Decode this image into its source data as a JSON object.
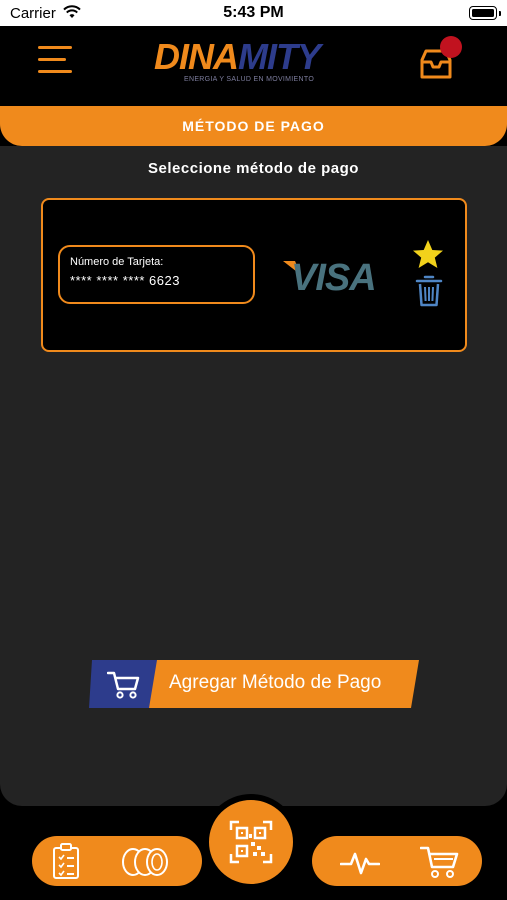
{
  "status_bar": {
    "carrier": "Carrier",
    "time": "5:43 PM"
  },
  "header": {
    "logo_part1": "DINA",
    "logo_part2": "MITY",
    "logo_tagline": "ENERGIA Y SALUD EN MOVIMIENTO",
    "menu_icon": "hamburger-menu-icon",
    "inbox_icon": "inbox-icon"
  },
  "title_bar": {
    "title": "MÉTODO DE PAGO"
  },
  "main": {
    "subtitle": "Seleccione método de pago",
    "cards": [
      {
        "number_label": "Número de Tarjeta:",
        "number_value": "**** **** **** 6623",
        "brand": "VISA",
        "is_favorite": true
      }
    ],
    "add_button_label": "Agregar Método de Pago"
  },
  "bottom_nav": {
    "items": [
      {
        "icon": "clipboard-icon"
      },
      {
        "icon": "coins-icon"
      },
      {
        "icon": "qr-code-icon"
      },
      {
        "icon": "activity-pulse-icon"
      },
      {
        "icon": "shopping-cart-icon"
      }
    ]
  },
  "colors": {
    "accent_orange": "#f08a1c",
    "brand_blue": "#2d3c8c",
    "card_background": "#000000",
    "content_background": "#232323",
    "notification_red": "#c1121f",
    "star_yellow": "#f2d21b",
    "trash_blue": "#4f86c6"
  }
}
